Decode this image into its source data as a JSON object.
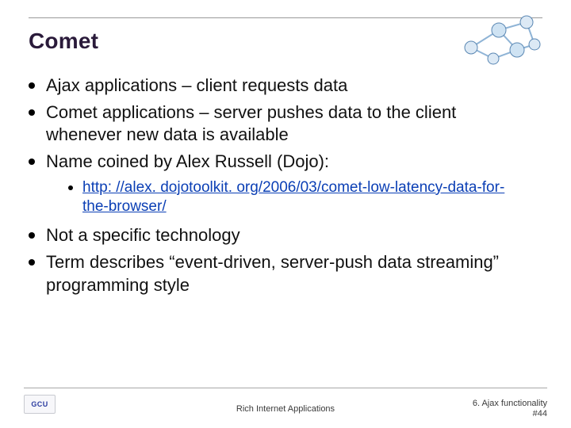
{
  "title": "Comet",
  "bullets_a": [
    "Ajax applications – client requests data",
    "Comet applications – server pushes data to the client whenever new data is available",
    "Name coined by Alex Russell (Dojo):"
  ],
  "sublink": "http: //alex. dojotoolkit. org/2006/03/comet-low-latency-data-for-the-browser/",
  "bullets_b": [
    "Not a specific technology",
    "Term describes “event-driven, server-push data streaming” programming style"
  ],
  "footer": {
    "logo_text": "GCU",
    "center": "Rich Internet Applications",
    "right_line1": "6. Ajax functionality",
    "right_line2": "#44"
  }
}
